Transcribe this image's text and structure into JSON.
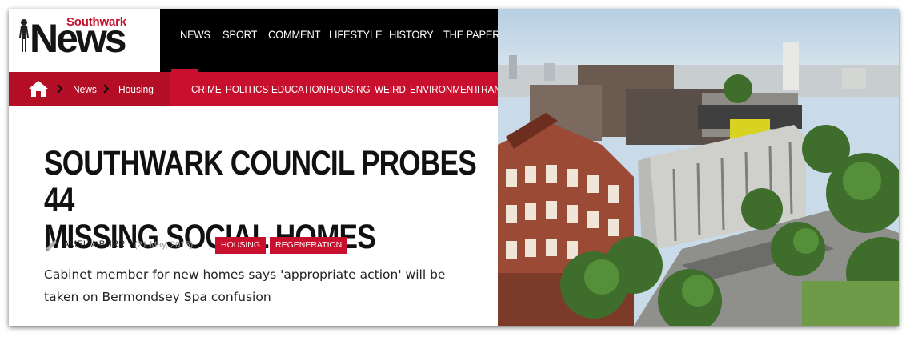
{
  "logo": {
    "small_text": "Southwark",
    "big_text": "News"
  },
  "topnav": {
    "items": [
      "NEWS",
      "SPORT",
      "COMMENT",
      "LIFESTYLE",
      "HISTORY",
      "THE PAPER"
    ],
    "active": "NEWS"
  },
  "breadcrumb": {
    "items": [
      "News",
      "Housing"
    ]
  },
  "categories": [
    "CRIME",
    "POLITICS",
    "EDUCATION",
    "HOUSING",
    "WEIRD",
    "ENVIRONMENT",
    "TRAN"
  ],
  "article": {
    "headline_line1": "SOUTHWARK COUNCIL PROBES  44",
    "headline_line2": "MISSING SOCIAL HOMES",
    "author": "AMELIA BURR",
    "date": "(21 May, 2015)",
    "tags": [
      "HOUSING",
      "REGENERATION"
    ],
    "standfirst_line1": "Cabinet member for new homes says 'appropriate action' will be",
    "standfirst_line2": "taken on Bermondsey Spa confusion"
  },
  "colors": {
    "brand_red": "#c8102e",
    "nav_black": "#000000"
  },
  "icons": [
    "home-icon",
    "chevron-right-icon",
    "pencil-icon"
  ]
}
